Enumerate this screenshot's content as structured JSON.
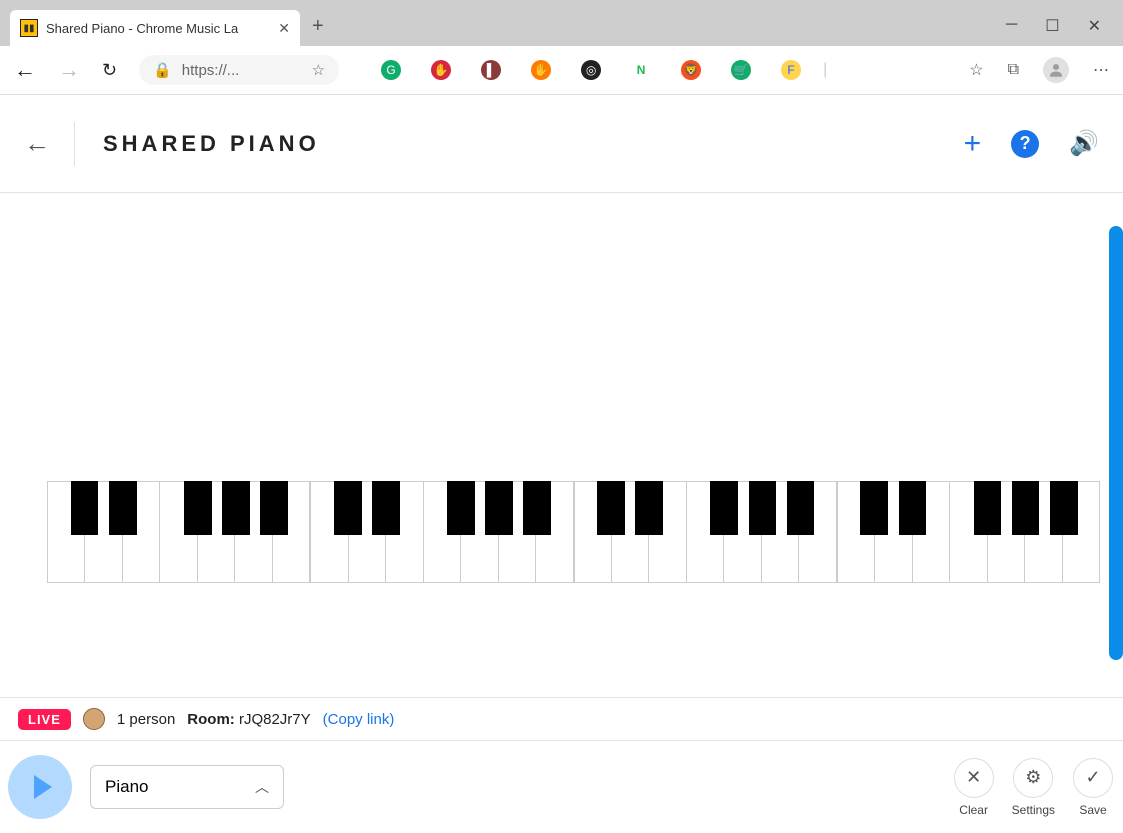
{
  "browser": {
    "tab_title": "Shared Piano - Chrome Music La",
    "url_display": "https://...",
    "extensions": [
      {
        "name": "grammarly",
        "bg": "#0ead69",
        "glyph": "G"
      },
      {
        "name": "adblock",
        "bg": "#d7263d",
        "glyph": "✋"
      },
      {
        "name": "books",
        "bg": "#8b3a3a",
        "glyph": "▌"
      },
      {
        "name": "puppet",
        "bg": "#ff7b00",
        "glyph": "✋"
      },
      {
        "name": "target",
        "bg": "#222",
        "glyph": "◎"
      },
      {
        "name": "netflix",
        "bg": "transparent",
        "glyph": "N",
        "color": "#1db954",
        "bold": true
      },
      {
        "name": "brave",
        "bg": "#f4511e",
        "glyph": "🦁"
      },
      {
        "name": "cart",
        "bg": "#0ead69",
        "glyph": "🛒"
      },
      {
        "name": "flipkart",
        "bg": "#ffd54f",
        "glyph": "F",
        "color": "#2962ff"
      }
    ]
  },
  "app": {
    "title": "SHARED PIANO"
  },
  "status": {
    "live": "LIVE",
    "people": "1 person",
    "room_label": "Room:",
    "room_id": "rJQ82Jr7Y",
    "copy_link": "(Copy link)"
  },
  "controls": {
    "instrument": "Piano",
    "clear": "Clear",
    "settings": "Settings",
    "save": "Save"
  },
  "piano": {
    "octaves": 4,
    "black_positions_pct": [
      9,
      23.5,
      52,
      66.5,
      81
    ]
  }
}
